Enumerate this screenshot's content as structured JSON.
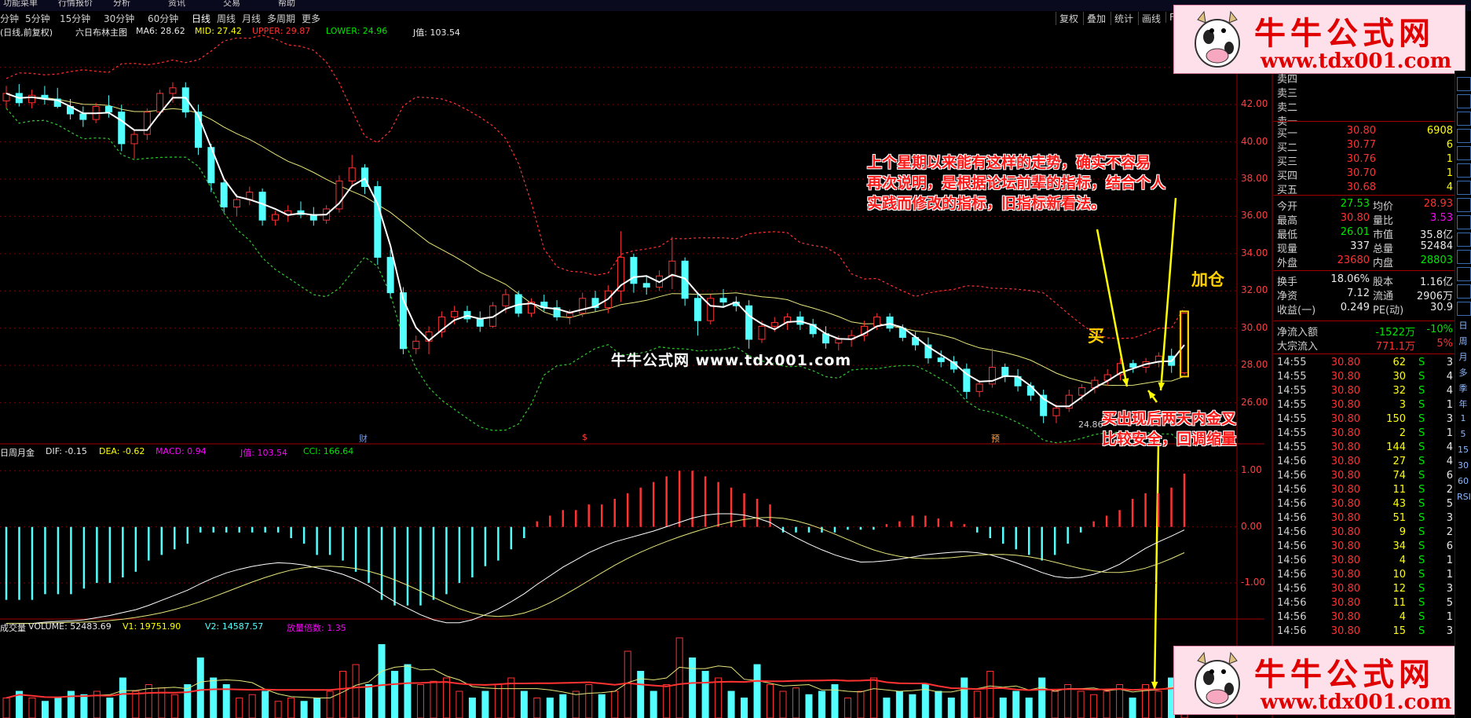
{
  "topbar": {
    "items": [
      "功能菜单",
      "行情报价",
      "分析",
      "资讯",
      "交易",
      "帮助"
    ]
  },
  "toolbar": {
    "timeframes": [
      "分钟",
      "5分钟",
      "15分钟",
      "30分钟",
      "60分钟",
      "日线",
      "周线",
      "月线",
      "多周期",
      "更多"
    ],
    "active_timeframe": "日线",
    "right_buttons": [
      "复权",
      "叠加",
      "统计",
      "画线",
      "F"
    ]
  },
  "main_indicator": {
    "title": "(日线,前复权)",
    "formula": "六日布林主图",
    "ma6": "MA6: 28.62",
    "mid": "MID: 27.42",
    "upper": "UPPER: 29.87",
    "lower": "LOWER: 24.96",
    "j": "J值: 103.54"
  },
  "macd_indicator": {
    "name": "日周月金",
    "dif": "DIF: -0.15",
    "dea": "DEA: -0.62",
    "macd": "MACD: 0.94",
    "j": "J值: 103.54",
    "cci": "CCI: 166.64"
  },
  "volume_indicator": {
    "name": "成交量",
    "volume": "VOLUME: 52483.69",
    "v1": "V1: 19751.90",
    "v2": "V2: 14587.57",
    "ratio": "放量倍数: 1.35"
  },
  "price_axis": [
    "44.00",
    "42.00",
    "40.00",
    "38.00",
    "36.00",
    "34.00",
    "32.00",
    "30.00",
    "28.00",
    "26.00"
  ],
  "macd_axis": [
    "1.00",
    "0.00",
    "-1.00"
  ],
  "markers": {
    "low": "24.86",
    "event1": "财",
    "event2": "$",
    "event3": "预",
    "buy": "买",
    "add": "加仓"
  },
  "annotations": {
    "note1_line1": "上个星期以来能有这样的走势，确实不容易",
    "note1_line2": "再次说明，是根据论坛前辈的指标，结合个人",
    "note1_line3": "实践而修改的指标，旧指标新看法。",
    "note2_line1": "买出现后两天内金叉",
    "note2_line2": "比较安全，回调缩量"
  },
  "watermark": "牛牛公式网  www.tdx001.com",
  "banner": {
    "title": "牛牛公式网",
    "url": "www.tdx001.com"
  },
  "sell_labels": [
    "卖四",
    "卖三",
    "卖二",
    "卖一"
  ],
  "buy_orders": [
    {
      "label": "买一",
      "price": "30.80",
      "vol": "6908"
    },
    {
      "label": "买二",
      "price": "30.77",
      "vol": "6"
    },
    {
      "label": "买三",
      "price": "30.76",
      "vol": "1"
    },
    {
      "label": "买四",
      "price": "30.70",
      "vol": "1"
    },
    {
      "label": "买五",
      "price": "30.68",
      "vol": "4"
    }
  ],
  "quote": [
    {
      "l1": "今开",
      "v1": "27.53",
      "c1": "grn",
      "l2": "均价",
      "v2": "28.93",
      "c2": "red"
    },
    {
      "l1": "最高",
      "v1": "30.80",
      "c1": "red",
      "l2": "量比",
      "v2": "3.53",
      "c2": "mag"
    },
    {
      "l1": "最低",
      "v1": "26.01",
      "c1": "grn",
      "l2": "市值",
      "v2": "35.8亿",
      "c2": "wht"
    },
    {
      "l1": "现量",
      "v1": "337",
      "c1": "wht",
      "l2": "总量",
      "v2": "52484",
      "c2": "wht"
    },
    {
      "l1": "外盘",
      "v1": "23680",
      "c1": "red",
      "l2": "内盘",
      "v2": "28803",
      "c2": "grn"
    }
  ],
  "fundamentals": [
    {
      "l1": "换手",
      "v1": "18.06%",
      "l2": "股本",
      "v2": "1.16亿"
    },
    {
      "l1": "净资",
      "v1": "7.12",
      "l2": "流通",
      "v2": "2906万"
    },
    {
      "l1": "收益(一)",
      "v1": "0.249",
      "l2": "PE(动)",
      "v2": "30.9"
    }
  ],
  "flows": [
    {
      "label": "净流入额",
      "v1": "-1522万",
      "v2": "-10%"
    },
    {
      "label": "大宗流入",
      "v1": "771.1万",
      "v2": "5%"
    }
  ],
  "ticks": [
    {
      "t": "14:55",
      "p": "30.80",
      "v": "62",
      "s": "S",
      "n": "3"
    },
    {
      "t": "14:55",
      "p": "30.80",
      "v": "30",
      "s": "S",
      "n": "4"
    },
    {
      "t": "14:55",
      "p": "30.80",
      "v": "32",
      "s": "S",
      "n": "4"
    },
    {
      "t": "14:55",
      "p": "30.80",
      "v": "3",
      "s": "S",
      "n": "1"
    },
    {
      "t": "14:55",
      "p": "30.80",
      "v": "150",
      "s": "S",
      "n": "3"
    },
    {
      "t": "14:55",
      "p": "30.80",
      "v": "2",
      "s": "S",
      "n": "1"
    },
    {
      "t": "14:55",
      "p": "30.80",
      "v": "144",
      "s": "S",
      "n": "4"
    },
    {
      "t": "14:56",
      "p": "30.80",
      "v": "27",
      "s": "S",
      "n": "4"
    },
    {
      "t": "14:56",
      "p": "30.80",
      "v": "74",
      "s": "S",
      "n": "6"
    },
    {
      "t": "14:56",
      "p": "30.80",
      "v": "11",
      "s": "S",
      "n": "2"
    },
    {
      "t": "14:56",
      "p": "30.80",
      "v": "43",
      "s": "S",
      "n": "5"
    },
    {
      "t": "14:56",
      "p": "30.80",
      "v": "51",
      "s": "S",
      "n": "3"
    },
    {
      "t": "14:56",
      "p": "30.80",
      "v": "9",
      "s": "S",
      "n": "2"
    },
    {
      "t": "14:56",
      "p": "30.80",
      "v": "34",
      "s": "S",
      "n": "6"
    },
    {
      "t": "14:56",
      "p": "30.80",
      "v": "4",
      "s": "S",
      "n": "1"
    },
    {
      "t": "14:56",
      "p": "30.80",
      "v": "10",
      "s": "S",
      "n": "1"
    },
    {
      "t": "14:56",
      "p": "30.80",
      "v": "12",
      "s": "S",
      "n": "3"
    },
    {
      "t": "14:56",
      "p": "30.80",
      "v": "11",
      "s": "S",
      "n": "5"
    },
    {
      "t": "14:56",
      "p": "30.80",
      "v": "4",
      "s": "S",
      "n": "1"
    },
    {
      "t": "14:56",
      "p": "30.80",
      "v": "15",
      "s": "S",
      "n": "3"
    }
  ],
  "right_tools": [
    "日",
    "周",
    "月",
    "多",
    "季",
    "年",
    "1",
    "5",
    "15",
    "30",
    "60",
    "RSI"
  ],
  "colors": {
    "up": "#ff3232",
    "down": "#54ffff",
    "ma": "#ffffff",
    "mid": "#e6e67a",
    "upper": "#ff3232",
    "lower": "#32c832",
    "grid": "#7a0000",
    "note": "#ff1a1a",
    "arrow": "#ffff00"
  },
  "chart_data": {
    "type": "candlestick",
    "price_ylim": [
      24,
      45
    ],
    "candles": [
      {
        "o": 42.2,
        "h": 43.0,
        "l": 41.8,
        "c": 42.6
      },
      {
        "o": 42.6,
        "h": 43.1,
        "l": 41.9,
        "c": 42.1
      },
      {
        "o": 42.1,
        "h": 42.8,
        "l": 41.8,
        "c": 42.5
      },
      {
        "o": 42.5,
        "h": 43.0,
        "l": 42.0,
        "c": 42.3
      },
      {
        "o": 42.3,
        "h": 42.9,
        "l": 41.8,
        "c": 41.9
      },
      {
        "o": 41.9,
        "h": 42.3,
        "l": 41.2,
        "c": 41.5
      },
      {
        "o": 41.5,
        "h": 41.9,
        "l": 40.8,
        "c": 41.2
      },
      {
        "o": 41.2,
        "h": 42.1,
        "l": 41.0,
        "c": 41.9
      },
      {
        "o": 41.9,
        "h": 42.5,
        "l": 41.3,
        "c": 41.6
      },
      {
        "o": 41.6,
        "h": 42.0,
        "l": 39.5,
        "c": 39.9
      },
      {
        "o": 39.9,
        "h": 40.6,
        "l": 39.1,
        "c": 40.4
      },
      {
        "o": 40.4,
        "h": 41.8,
        "l": 40.1,
        "c": 41.6
      },
      {
        "o": 41.6,
        "h": 42.8,
        "l": 41.4,
        "c": 42.6
      },
      {
        "o": 42.6,
        "h": 43.2,
        "l": 42.1,
        "c": 42.9
      },
      {
        "o": 42.9,
        "h": 43.2,
        "l": 41.3,
        "c": 41.6
      },
      {
        "o": 41.6,
        "h": 42.0,
        "l": 39.3,
        "c": 39.7
      },
      {
        "o": 39.7,
        "h": 39.9,
        "l": 37.3,
        "c": 37.8
      },
      {
        "o": 37.8,
        "h": 38.0,
        "l": 36.2,
        "c": 36.5
      },
      {
        "o": 36.5,
        "h": 37.2,
        "l": 36.0,
        "c": 36.9
      },
      {
        "o": 36.9,
        "h": 37.6,
        "l": 36.6,
        "c": 37.3
      },
      {
        "o": 37.3,
        "h": 37.5,
        "l": 35.5,
        "c": 35.8
      },
      {
        "o": 35.8,
        "h": 36.3,
        "l": 35.5,
        "c": 36.1
      },
      {
        "o": 36.1,
        "h": 36.6,
        "l": 35.7,
        "c": 36.3
      },
      {
        "o": 36.3,
        "h": 36.8,
        "l": 35.9,
        "c": 36.1
      },
      {
        "o": 36.1,
        "h": 36.5,
        "l": 35.5,
        "c": 35.8
      },
      {
        "o": 35.8,
        "h": 36.6,
        "l": 35.6,
        "c": 36.4
      },
      {
        "o": 36.4,
        "h": 38.2,
        "l": 36.2,
        "c": 37.9
      },
      {
        "o": 37.9,
        "h": 39.3,
        "l": 37.6,
        "c": 38.6
      },
      {
        "o": 38.6,
        "h": 38.8,
        "l": 37.2,
        "c": 37.6
      },
      {
        "o": 37.6,
        "h": 37.9,
        "l": 33.4,
        "c": 33.8
      },
      {
        "o": 33.8,
        "h": 34.2,
        "l": 31.6,
        "c": 31.9
      },
      {
        "o": 31.9,
        "h": 32.2,
        "l": 28.6,
        "c": 28.9
      },
      {
        "o": 28.9,
        "h": 29.6,
        "l": 28.6,
        "c": 29.3
      },
      {
        "o": 29.3,
        "h": 30.1,
        "l": 28.6,
        "c": 29.8
      },
      {
        "o": 29.8,
        "h": 30.9,
        "l": 29.5,
        "c": 30.6
      },
      {
        "o": 30.6,
        "h": 31.2,
        "l": 30.2,
        "c": 30.9
      },
      {
        "o": 30.9,
        "h": 31.2,
        "l": 30.3,
        "c": 30.5
      },
      {
        "o": 30.5,
        "h": 30.9,
        "l": 29.8,
        "c": 30.1
      },
      {
        "o": 30.1,
        "h": 31.4,
        "l": 30.0,
        "c": 31.2
      },
      {
        "o": 31.2,
        "h": 32.1,
        "l": 30.8,
        "c": 31.8
      },
      {
        "o": 31.8,
        "h": 32.0,
        "l": 30.6,
        "c": 30.8
      },
      {
        "o": 30.8,
        "h": 31.6,
        "l": 30.6,
        "c": 31.4
      },
      {
        "o": 31.4,
        "h": 31.8,
        "l": 30.9,
        "c": 31.1
      },
      {
        "o": 31.1,
        "h": 31.5,
        "l": 30.4,
        "c": 30.6
      },
      {
        "o": 30.6,
        "h": 31.0,
        "l": 30.2,
        "c": 30.8
      },
      {
        "o": 30.8,
        "h": 31.9,
        "l": 30.6,
        "c": 31.6
      },
      {
        "o": 31.6,
        "h": 32.0,
        "l": 30.9,
        "c": 31.1
      },
      {
        "o": 31.1,
        "h": 32.3,
        "l": 30.8,
        "c": 32.0
      },
      {
        "o": 32.0,
        "h": 35.2,
        "l": 31.4,
        "c": 33.8
      },
      {
        "o": 33.8,
        "h": 34.0,
        "l": 31.9,
        "c": 32.4
      },
      {
        "o": 32.4,
        "h": 32.8,
        "l": 31.8,
        "c": 32.2
      },
      {
        "o": 32.2,
        "h": 33.1,
        "l": 32.0,
        "c": 32.8
      },
      {
        "o": 32.8,
        "h": 34.9,
        "l": 32.1,
        "c": 33.6
      },
      {
        "o": 33.6,
        "h": 33.8,
        "l": 31.2,
        "c": 31.6
      },
      {
        "o": 31.6,
        "h": 31.9,
        "l": 29.6,
        "c": 30.4
      },
      {
        "o": 30.4,
        "h": 31.8,
        "l": 30.2,
        "c": 31.6
      },
      {
        "o": 31.6,
        "h": 32.1,
        "l": 31.1,
        "c": 31.4
      },
      {
        "o": 31.4,
        "h": 31.7,
        "l": 30.9,
        "c": 31.2
      },
      {
        "o": 31.2,
        "h": 31.5,
        "l": 28.9,
        "c": 29.4
      },
      {
        "o": 29.4,
        "h": 30.4,
        "l": 29.2,
        "c": 30.1
      },
      {
        "o": 30.1,
        "h": 30.6,
        "l": 29.8,
        "c": 30.3
      },
      {
        "o": 30.3,
        "h": 30.8,
        "l": 29.9,
        "c": 30.6
      },
      {
        "o": 30.6,
        "h": 30.9,
        "l": 29.9,
        "c": 30.2
      },
      {
        "o": 30.2,
        "h": 30.5,
        "l": 29.5,
        "c": 29.7
      },
      {
        "o": 29.7,
        "h": 30.1,
        "l": 28.9,
        "c": 29.2
      },
      {
        "o": 29.2,
        "h": 29.6,
        "l": 28.8,
        "c": 29.4
      },
      {
        "o": 29.4,
        "h": 29.9,
        "l": 29.0,
        "c": 29.6
      },
      {
        "o": 29.6,
        "h": 30.4,
        "l": 29.3,
        "c": 30.1
      },
      {
        "o": 30.1,
        "h": 30.8,
        "l": 29.9,
        "c": 30.6
      },
      {
        "o": 30.6,
        "h": 30.8,
        "l": 29.8,
        "c": 30.0
      },
      {
        "o": 30.0,
        "h": 30.2,
        "l": 29.3,
        "c": 29.5
      },
      {
        "o": 29.5,
        "h": 29.8,
        "l": 28.8,
        "c": 29.1
      },
      {
        "o": 29.1,
        "h": 29.5,
        "l": 28.1,
        "c": 28.4
      },
      {
        "o": 28.4,
        "h": 28.8,
        "l": 27.9,
        "c": 28.2
      },
      {
        "o": 28.2,
        "h": 28.5,
        "l": 27.6,
        "c": 27.8
      },
      {
        "o": 27.8,
        "h": 28.1,
        "l": 26.2,
        "c": 26.6
      },
      {
        "o": 26.6,
        "h": 27.2,
        "l": 26.3,
        "c": 27.0
      },
      {
        "o": 27.0,
        "h": 28.9,
        "l": 26.8,
        "c": 27.9
      },
      {
        "o": 27.9,
        "h": 28.1,
        "l": 27.1,
        "c": 27.4
      },
      {
        "o": 27.4,
        "h": 27.8,
        "l": 26.6,
        "c": 26.9
      },
      {
        "o": 26.9,
        "h": 27.1,
        "l": 26.1,
        "c": 26.4
      },
      {
        "o": 26.4,
        "h": 26.7,
        "l": 24.9,
        "c": 25.3
      },
      {
        "o": 25.3,
        "h": 25.9,
        "l": 24.9,
        "c": 25.7
      },
      {
        "o": 25.7,
        "h": 26.7,
        "l": 25.5,
        "c": 26.4
      },
      {
        "o": 26.4,
        "h": 27.0,
        "l": 26.1,
        "c": 26.8
      },
      {
        "o": 26.8,
        "h": 27.4,
        "l": 26.5,
        "c": 27.2
      },
      {
        "o": 27.2,
        "h": 27.8,
        "l": 26.9,
        "c": 27.5
      },
      {
        "o": 27.5,
        "h": 28.4,
        "l": 27.2,
        "c": 28.1
      },
      {
        "o": 28.1,
        "h": 28.3,
        "l": 27.6,
        "c": 27.9
      },
      {
        "o": 27.9,
        "h": 28.4,
        "l": 27.6,
        "c": 28.2
      },
      {
        "o": 28.2,
        "h": 28.7,
        "l": 27.9,
        "c": 28.5
      },
      {
        "o": 28.5,
        "h": 28.9,
        "l": 27.6,
        "c": 28.0
      },
      {
        "o": 27.6,
        "h": 30.8,
        "l": 27.5,
        "c": 30.8
      }
    ],
    "volumes": [
      {
        "v": 3,
        "u": 1
      },
      {
        "v": 4,
        "u": 0
      },
      {
        "v": 3,
        "u": 1
      },
      {
        "v": 2.5,
        "u": 0
      },
      {
        "v": 3,
        "u": 0
      },
      {
        "v": 4,
        "u": 0
      },
      {
        "v": 3.5,
        "u": 0
      },
      {
        "v": 4,
        "u": 1
      },
      {
        "v": 3,
        "u": 0
      },
      {
        "v": 6,
        "u": 0
      },
      {
        "v": 4,
        "u": 1
      },
      {
        "v": 5,
        "u": 1
      },
      {
        "v": 4.5,
        "u": 1
      },
      {
        "v": 3.5,
        "u": 1
      },
      {
        "v": 5,
        "u": 0
      },
      {
        "v": 9,
        "u": 0
      },
      {
        "v": 6,
        "u": 0
      },
      {
        "v": 5,
        "u": 0
      },
      {
        "v": 3,
        "u": 1
      },
      {
        "v": 3.5,
        "u": 1
      },
      {
        "v": 4,
        "u": 0
      },
      {
        "v": 2.5,
        "u": 1
      },
      {
        "v": 3,
        "u": 1
      },
      {
        "v": 2.5,
        "u": 0
      },
      {
        "v": 3,
        "u": 0
      },
      {
        "v": 4,
        "u": 1
      },
      {
        "v": 7,
        "u": 1
      },
      {
        "v": 8,
        "u": 1
      },
      {
        "v": 5,
        "u": 0
      },
      {
        "v": 11,
        "u": 0
      },
      {
        "v": 7,
        "u": 0
      },
      {
        "v": 8,
        "u": 0
      },
      {
        "v": 5,
        "u": 1
      },
      {
        "v": 5.5,
        "u": 1
      },
      {
        "v": 6,
        "u": 1
      },
      {
        "v": 4,
        "u": 1
      },
      {
        "v": 3,
        "u": 0
      },
      {
        "v": 4,
        "u": 0
      },
      {
        "v": 5,
        "u": 1
      },
      {
        "v": 6,
        "u": 1
      },
      {
        "v": 4,
        "u": 0
      },
      {
        "v": 3,
        "u": 1
      },
      {
        "v": 3,
        "u": 0
      },
      {
        "v": 3.5,
        "u": 0
      },
      {
        "v": 4,
        "u": 1
      },
      {
        "v": 5,
        "u": 1
      },
      {
        "v": 3.5,
        "u": 0
      },
      {
        "v": 4,
        "u": 1
      },
      {
        "v": 10,
        "u": 1
      },
      {
        "v": 7,
        "u": 0
      },
      {
        "v": 4,
        "u": 0
      },
      {
        "v": 5,
        "u": 1
      },
      {
        "v": 12,
        "u": 1
      },
      {
        "v": 9,
        "u": 0
      },
      {
        "v": 7,
        "u": 0
      },
      {
        "v": 6,
        "u": 1
      },
      {
        "v": 4,
        "u": 0
      },
      {
        "v": 3,
        "u": 0
      },
      {
        "v": 8,
        "u": 0
      },
      {
        "v": 5,
        "u": 1
      },
      {
        "v": 4,
        "u": 1
      },
      {
        "v": 4.5,
        "u": 1
      },
      {
        "v": 3.5,
        "u": 0
      },
      {
        "v": 4,
        "u": 0
      },
      {
        "v": 5,
        "u": 0
      },
      {
        "v": 3,
        "u": 1
      },
      {
        "v": 4,
        "u": 1
      },
      {
        "v": 6,
        "u": 1
      },
      {
        "v": 3,
        "u": 0
      },
      {
        "v": 4,
        "u": 0
      },
      {
        "v": 3.5,
        "u": 0
      },
      {
        "v": 5,
        "u": 0
      },
      {
        "v": 4,
        "u": 0
      },
      {
        "v": 3,
        "u": 0
      },
      {
        "v": 6,
        "u": 0
      },
      {
        "v": 4,
        "u": 1
      },
      {
        "v": 7,
        "u": 1
      },
      {
        "v": 3,
        "u": 0
      },
      {
        "v": 4,
        "u": 0
      },
      {
        "v": 3,
        "u": 0
      },
      {
        "v": 6,
        "u": 0
      },
      {
        "v": 4,
        "u": 1
      },
      {
        "v": 5,
        "u": 1
      },
      {
        "v": 4,
        "u": 1
      },
      {
        "v": 3.5,
        "u": 1
      },
      {
        "v": 4,
        "u": 1
      },
      {
        "v": 5,
        "u": 1
      },
      {
        "v": 3,
        "u": 0
      },
      {
        "v": 5,
        "u": 1
      },
      {
        "v": 4,
        "u": 1
      },
      {
        "v": 6,
        "u": 0
      },
      {
        "v": 9,
        "u": 1
      }
    ],
    "macd_hist": [
      -1.3,
      -1.3,
      -1.3,
      -1.2,
      -1.2,
      -1.2,
      -1.1,
      -1.0,
      -1.0,
      -0.9,
      -0.8,
      -0.6,
      -0.5,
      -0.4,
      -0.3,
      -0.1,
      -0.1,
      -0.1,
      -0.1,
      -0.1,
      -0.1,
      -0.1,
      -0.2,
      -0.3,
      -0.5,
      -0.5,
      -0.6,
      -0.8,
      -1.0,
      -1.3,
      -1.4,
      -1.4,
      -1.4,
      -1.3,
      -1.2,
      -1.0,
      -0.9,
      -0.7,
      -0.6,
      -0.4,
      -0.2,
      0.1,
      0.2,
      0.3,
      0.3,
      0.4,
      0.4,
      0.5,
      0.6,
      0.7,
      0.8,
      0.9,
      1.0,
      1.0,
      0.9,
      0.8,
      0.7,
      0.6,
      0.5,
      0.4,
      -0.1,
      -0.1,
      -0.1,
      -0.1,
      -0.1,
      -0.05,
      -0.05,
      -0.05,
      0.05,
      0.1,
      0.2,
      0.2,
      0.15,
      0.1,
      0.05,
      -0.1,
      -0.2,
      -0.3,
      -0.4,
      -0.5,
      -0.6,
      -0.5,
      -0.3,
      -0.1,
      0.1,
      0.2,
      0.3,
      0.5,
      0.6,
      0.6,
      0.7,
      0.95
    ],
    "ylim_macd": [
      -1.6,
      1.2
    ]
  }
}
